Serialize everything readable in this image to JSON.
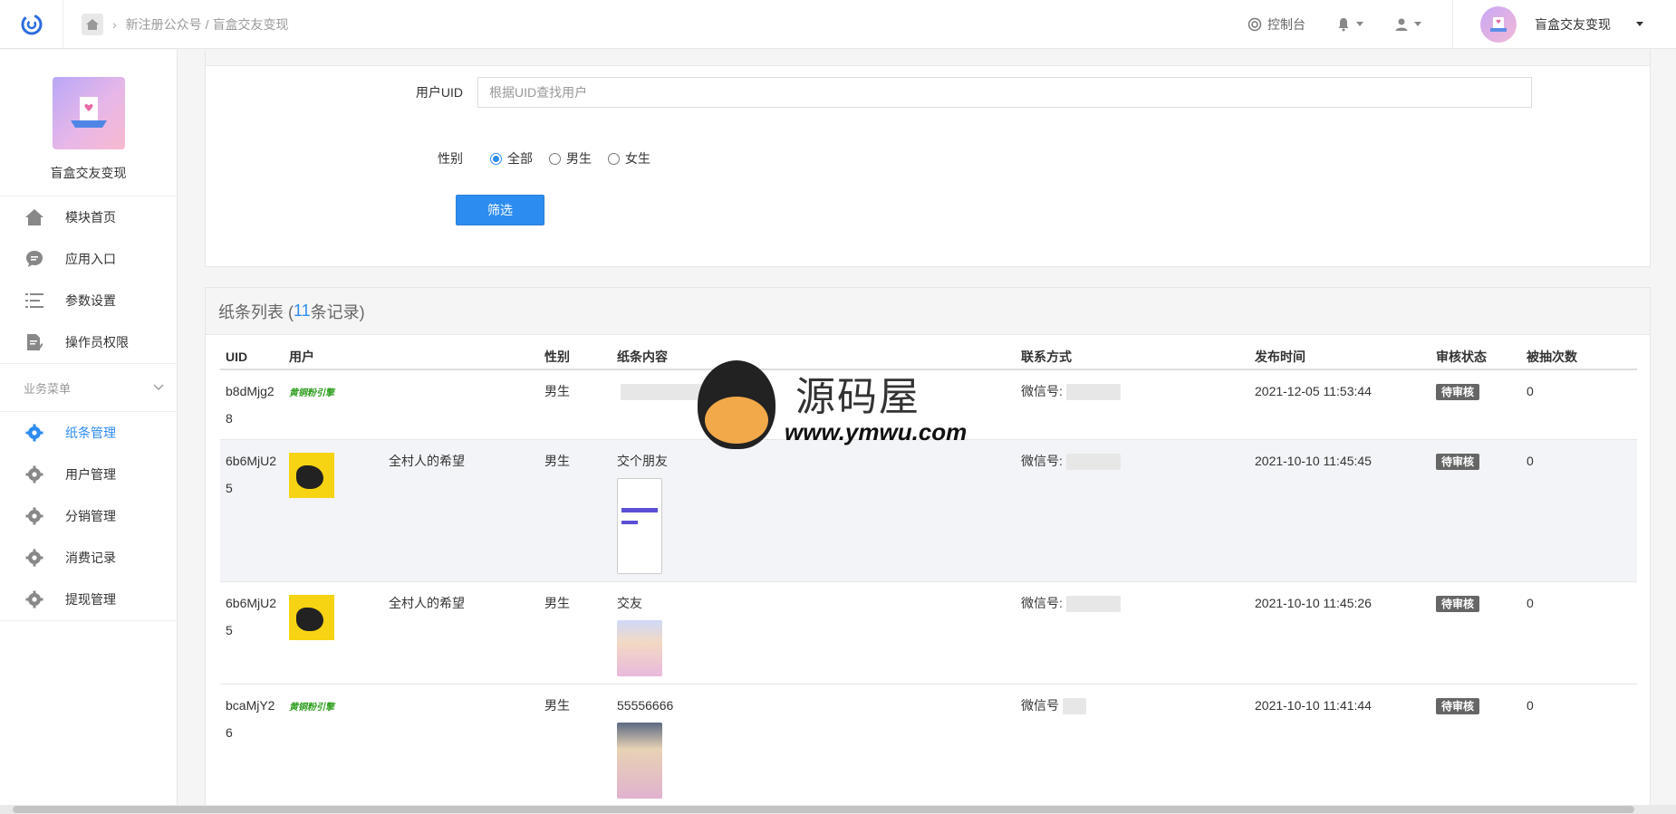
{
  "breadcrumb": {
    "parent": "新注册公众号",
    "separator": "/",
    "current": "盲盒交友变现"
  },
  "header": {
    "console_label": "控制台",
    "account_name": "盲盒交友变现"
  },
  "sidebar": {
    "brand_name": "盲盒交友变现",
    "items": [
      {
        "label": "模块首页",
        "icon": "home-icon"
      },
      {
        "label": "应用入口",
        "icon": "chat-icon"
      },
      {
        "label": "参数设置",
        "icon": "list-icon"
      },
      {
        "label": "操作员权限",
        "icon": "edit-doc-icon"
      }
    ],
    "group_title": "业务菜单",
    "business_items": [
      {
        "label": "纸条管理",
        "icon": "gear-icon",
        "active": true
      },
      {
        "label": "用户管理",
        "icon": "gear-icon"
      },
      {
        "label": "分销管理",
        "icon": "gear-icon"
      },
      {
        "label": "消费记录",
        "icon": "gear-icon"
      },
      {
        "label": "提现管理",
        "icon": "gear-icon"
      }
    ]
  },
  "filter": {
    "uid_label": "用户UID",
    "uid_placeholder": "根据UID查找用户",
    "uid_value": "",
    "gender_label": "性别",
    "gender_options": [
      "全部",
      "男生",
      "女生"
    ],
    "gender_selected": "全部",
    "submit_label": "筛选"
  },
  "list": {
    "title_prefix": "纸条列表 (",
    "count": "11",
    "title_suffix": "条记录)",
    "columns": [
      "UID",
      "用户",
      "性别",
      "纸条内容",
      "联系方式",
      "发布时间",
      "审核状态",
      "被抽次数"
    ],
    "rows": [
      {
        "uid": "b8dMjg28",
        "nickname": "黄铜粉引擎",
        "user_name": "",
        "gender": "男生",
        "content": "",
        "contact_label": "微信号:",
        "time": "2021-12-05 11:53:44",
        "status": "待审核",
        "draws": "0"
      },
      {
        "uid": "6b6MjU25",
        "nickname": "",
        "user_name": "全村人的希望",
        "gender": "男生",
        "content": "交个朋友",
        "contact_label": "微信号:",
        "time": "2021-10-10 11:45:45",
        "status": "待审核",
        "draws": "0"
      },
      {
        "uid": "6b6MjU25",
        "nickname": "",
        "user_name": "全村人的希望",
        "gender": "男生",
        "content": "交友",
        "contact_label": "微信号:",
        "time": "2021-10-10 11:45:26",
        "status": "待审核",
        "draws": "0"
      },
      {
        "uid": "bcaMjY26",
        "nickname": "黄铜粉引擎",
        "user_name": "",
        "gender": "男生",
        "content": "55556666",
        "contact_label": "微信号",
        "time": "2021-10-10 11:41:44",
        "status": "待审核",
        "draws": "0"
      }
    ]
  },
  "watermark": {
    "cn": "源码屋",
    "url": "www.ymwu.com"
  },
  "colors": {
    "primary": "#2d8cf0",
    "status_badge": "#666666",
    "nickname_green": "#2e9e1e"
  }
}
